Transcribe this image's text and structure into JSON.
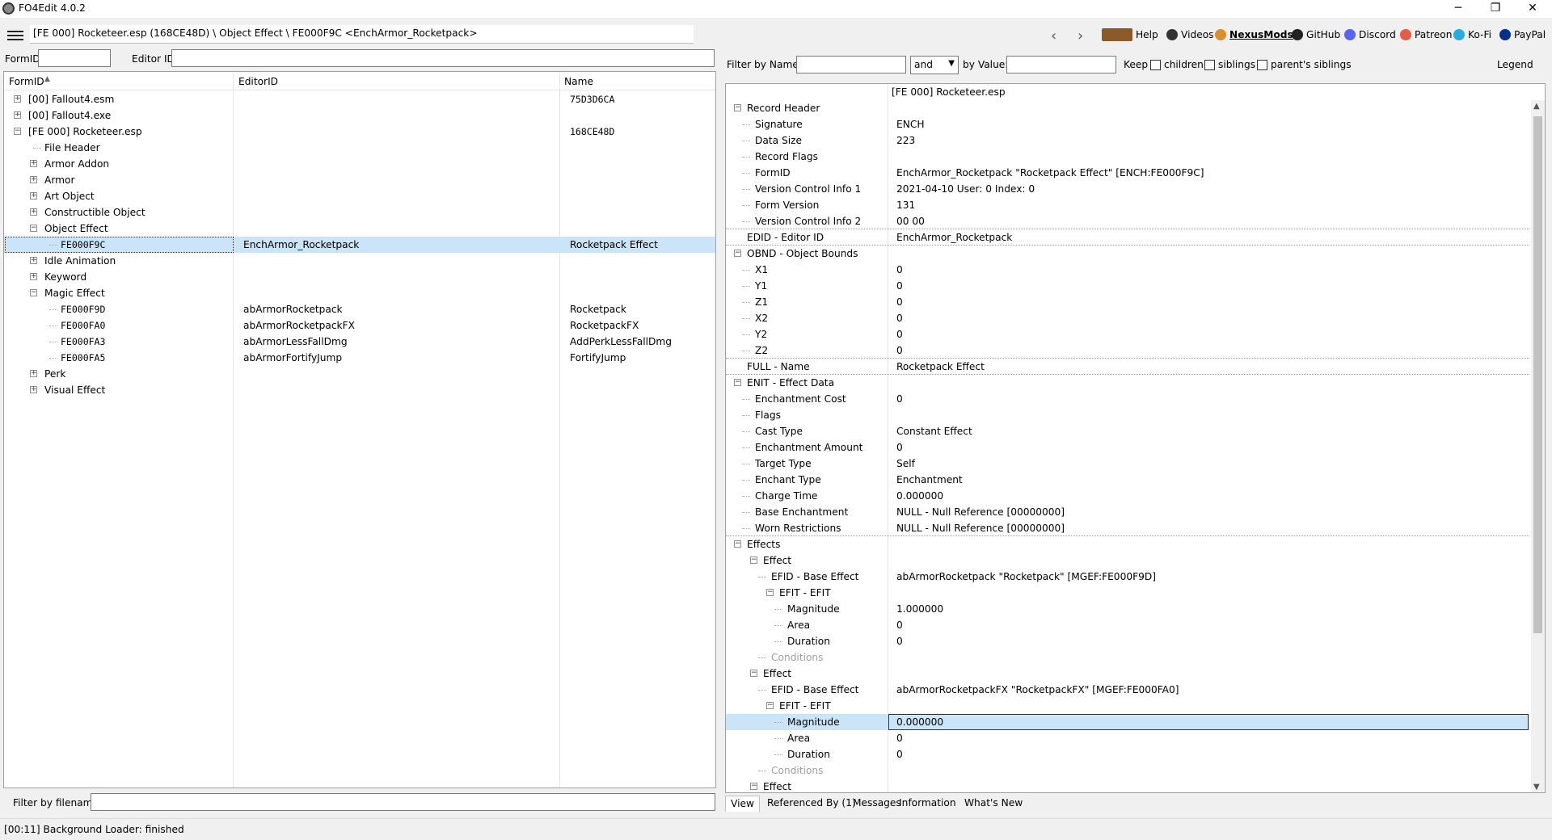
{
  "window": {
    "title": "FO4Edit 4.0.2",
    "minimize": "─",
    "restore": "❐",
    "close": "✕"
  },
  "toolbar": {
    "path": "[FE 000] Rocketeer.esp (168CE48D) \\ Object Effect \\ FE000F9C <EnchArmor_Rocketpack>",
    "back": "‹",
    "forward": "›",
    "links": [
      {
        "label": "Help",
        "icon": "book-icon",
        "color": "#8b5a2b"
      },
      {
        "label": "Videos",
        "icon": "video-icon",
        "color": "#333333"
      },
      {
        "label": "NexusMods",
        "icon": "nexus-icon",
        "color": "#d98f2b"
      },
      {
        "label": "GitHub",
        "icon": "github-icon",
        "color": "#222222"
      },
      {
        "label": "Discord",
        "icon": "discord-icon",
        "color": "#5865f2"
      },
      {
        "label": "Patreon",
        "icon": "patreon-icon",
        "color": "#e85b46"
      },
      {
        "label": "Ko-Fi",
        "icon": "kofi-icon",
        "color": "#29abe0"
      },
      {
        "label": "PayPal",
        "icon": "paypal-icon",
        "color": "#003087"
      }
    ]
  },
  "left": {
    "formid_label": "FormID",
    "editorid_label": "Editor ID",
    "columns": {
      "formid": "FormID",
      "editorid": "EditorID",
      "name": "Name"
    },
    "rows": [
      {
        "formid": "[00] Fallout4.esm",
        "editorid": "",
        "name": "75D3D6CA",
        "level": 0,
        "exp": "+"
      },
      {
        "formid": "[00] Fallout4.exe",
        "editorid": "",
        "name": "",
        "level": 0,
        "exp": "+"
      },
      {
        "formid": "[FE 000] Rocketeer.esp",
        "editorid": "",
        "name": "168CE48D",
        "level": 0,
        "exp": "−"
      },
      {
        "formid": "File Header",
        "editorid": "",
        "name": "",
        "level": 1,
        "exp": ""
      },
      {
        "formid": "Armor Addon",
        "editorid": "",
        "name": "",
        "level": 1,
        "exp": "+"
      },
      {
        "formid": "Armor",
        "editorid": "",
        "name": "",
        "level": 1,
        "exp": "+"
      },
      {
        "formid": "Art Object",
        "editorid": "",
        "name": "",
        "level": 1,
        "exp": "+"
      },
      {
        "formid": "Constructible Object",
        "editorid": "",
        "name": "",
        "level": 1,
        "exp": "+"
      },
      {
        "formid": "Object Effect",
        "editorid": "",
        "name": "",
        "level": 1,
        "exp": "−"
      },
      {
        "formid": "FE000F9C",
        "editorid": "EnchArmor_Rocketpack",
        "name": "Rocketpack Effect",
        "level": 2,
        "exp": "",
        "selected": true
      },
      {
        "formid": "Idle Animation",
        "editorid": "",
        "name": "",
        "level": 1,
        "exp": "+"
      },
      {
        "formid": "Keyword",
        "editorid": "",
        "name": "",
        "level": 1,
        "exp": "+"
      },
      {
        "formid": "Magic Effect",
        "editorid": "",
        "name": "",
        "level": 1,
        "exp": "−"
      },
      {
        "formid": "FE000F9D",
        "editorid": "abArmorRocketpack",
        "name": "Rocketpack",
        "level": 2,
        "exp": ""
      },
      {
        "formid": "FE000FA0",
        "editorid": "abArmorRocketpackFX",
        "name": "RocketpackFX",
        "level": 2,
        "exp": ""
      },
      {
        "formid": "FE000FA3",
        "editorid": "abArmorLessFallDmg",
        "name": "AddPerkLessFallDmg",
        "level": 2,
        "exp": ""
      },
      {
        "formid": "FE000FA5",
        "editorid": "abArmorFortifyJump",
        "name": "FortifyJump",
        "level": 2,
        "exp": ""
      },
      {
        "formid": "Perk",
        "editorid": "",
        "name": "",
        "level": 1,
        "exp": "+"
      },
      {
        "formid": "Visual Effect",
        "editorid": "",
        "name": "",
        "level": 1,
        "exp": "+"
      }
    ],
    "filter_filename_label": "Filter by filename:"
  },
  "right": {
    "filter_by_name": "Filter by Name:",
    "and_option": "and",
    "by_value": "by Value:",
    "keep": "Keep",
    "children": "children",
    "siblings": "siblings",
    "parents_siblings": "parent's siblings",
    "legend": "Legend",
    "header_value": "[FE 000] Rocketeer.esp",
    "rows": [
      {
        "n": "Record Header",
        "v": "",
        "level": 0,
        "exp": "−"
      },
      {
        "n": "Signature",
        "v": "ENCH",
        "level": 1
      },
      {
        "n": "Data Size",
        "v": "223",
        "level": 1
      },
      {
        "n": "Record Flags",
        "v": "",
        "level": 1
      },
      {
        "n": "FormID",
        "v": "EnchArmor_Rocketpack \"Rocketpack Effect\" [ENCH:FE000F9C]",
        "level": 1
      },
      {
        "n": "Version Control Info 1",
        "v": "2021-04-10 User: 0 Index: 0",
        "level": 1
      },
      {
        "n": "Form Version",
        "v": "131",
        "level": 1
      },
      {
        "n": "Version Control Info 2",
        "v": "00 00",
        "level": 1,
        "sep": true
      },
      {
        "n": "EDID - Editor ID",
        "v": "EnchArmor_Rocketpack",
        "level": 0,
        "sep": true
      },
      {
        "n": "OBND - Object Bounds",
        "v": "",
        "level": 0,
        "exp": "−"
      },
      {
        "n": "X1",
        "v": "0",
        "level": 1
      },
      {
        "n": "Y1",
        "v": "0",
        "level": 1
      },
      {
        "n": "Z1",
        "v": "0",
        "level": 1
      },
      {
        "n": "X2",
        "v": "0",
        "level": 1
      },
      {
        "n": "Y2",
        "v": "0",
        "level": 1
      },
      {
        "n": "Z2",
        "v": "0",
        "level": 1,
        "sep": true
      },
      {
        "n": "FULL - Name",
        "v": "Rocketpack Effect",
        "level": 0,
        "sep": true
      },
      {
        "n": "ENIT - Effect Data",
        "v": "",
        "level": 0,
        "exp": "−"
      },
      {
        "n": "Enchantment Cost",
        "v": "0",
        "level": 1
      },
      {
        "n": "Flags",
        "v": "",
        "level": 1
      },
      {
        "n": "Cast Type",
        "v": "Constant Effect",
        "level": 1
      },
      {
        "n": "Enchantment Amount",
        "v": "0",
        "level": 1
      },
      {
        "n": "Target Type",
        "v": "Self",
        "level": 1
      },
      {
        "n": "Enchant Type",
        "v": "Enchantment",
        "level": 1
      },
      {
        "n": "Charge Time",
        "v": "0.000000",
        "level": 1
      },
      {
        "n": "Base Enchantment",
        "v": "NULL - Null Reference [00000000]",
        "level": 1
      },
      {
        "n": "Worn Restrictions",
        "v": "NULL - Null Reference [00000000]",
        "level": 1,
        "sep": true
      },
      {
        "n": "Effects",
        "v": "",
        "level": 0,
        "exp": "−"
      },
      {
        "n": "Effect",
        "v": "",
        "level": 1,
        "exp": "−"
      },
      {
        "n": "EFID - Base Effect",
        "v": "abArmorRocketpack \"Rocketpack\" [MGEF:FE000F9D]",
        "level": 2
      },
      {
        "n": "EFIT - EFIT",
        "v": "",
        "level": 2,
        "exp": "−"
      },
      {
        "n": "Magnitude",
        "v": "1.000000",
        "level": 3
      },
      {
        "n": "Area",
        "v": "0",
        "level": 3
      },
      {
        "n": "Duration",
        "v": "0",
        "level": 3
      },
      {
        "n": "Conditions",
        "v": "",
        "level": 2,
        "gray": true
      },
      {
        "n": "Effect",
        "v": "",
        "level": 1,
        "exp": "−"
      },
      {
        "n": "EFID - Base Effect",
        "v": "abArmorRocketpackFX \"RocketpackFX\" [MGEF:FE000FA0]",
        "level": 2
      },
      {
        "n": "EFIT - EFIT",
        "v": "",
        "level": 2,
        "exp": "−"
      },
      {
        "n": "Magnitude",
        "v": "0.000000",
        "level": 3,
        "hl": true
      },
      {
        "n": "Area",
        "v": "0",
        "level": 3
      },
      {
        "n": "Duration",
        "v": "0",
        "level": 3
      },
      {
        "n": "Conditions",
        "v": "",
        "level": 2,
        "gray": true
      },
      {
        "n": "Effect",
        "v": "",
        "level": 1,
        "exp": "−"
      }
    ],
    "tabs": [
      "View",
      "Referenced By (1)",
      "Messages",
      "Information",
      "What's New"
    ]
  },
  "status": "[00:11] Background Loader: finished"
}
